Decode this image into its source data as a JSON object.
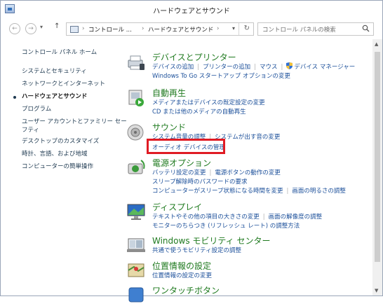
{
  "window": {
    "title": "ハードウェアとサウンド"
  },
  "address": {
    "segments": [
      "コントロール ...",
      "ハードウェアとサウンド"
    ],
    "search_placeholder": "コントロール パネルの検索"
  },
  "leftnav": {
    "home": "コントロール パネル ホーム",
    "items": [
      "システムとセキュリティ",
      "ネットワークとインターネット",
      "ハードウェアとサウンド",
      "プログラム",
      "ユーザー アカウントとファミリー セー",
      "フティ",
      "デスクトップのカスタマイズ",
      "時計、言語、および地域",
      "コンピューターの簡単操作"
    ]
  },
  "categories": {
    "devices": {
      "title": "デバイスとプリンター",
      "links": [
        "デバイスの追加",
        "プリンターの追加",
        "マウス",
        "デバイス マネージャー",
        "Windows To Go スタートアップ オプションの変更"
      ]
    },
    "autoplay": {
      "title": "自動再生",
      "links": [
        "メディアまたはデバイスの既定設定の変更",
        "CD または他のメディアの自動再生"
      ]
    },
    "sound": {
      "title": "サウンド",
      "links": [
        "システム音量の調整",
        "システムが出す音の変更",
        "オーディオ デバイスの管理"
      ]
    },
    "power": {
      "title": "電源オプション",
      "links": [
        "バッテリ設定の変更",
        "電源ボタンの動作の変更",
        "スリープ解除時のパスワードの要求",
        "コンピューターがスリープ状態になる時間を変更",
        "画面の明るさの調整"
      ]
    },
    "display": {
      "title": "ディスプレイ",
      "links": [
        "テキストやその他の項目の大きさの変更",
        "画面の解像度の調整",
        "モニターのちらつき (リフレッシュ レート) の調整方法"
      ]
    },
    "mobility": {
      "title": "Windows モビリティ センター",
      "links": [
        "共通で使うモビリティ設定の調整"
      ]
    },
    "location": {
      "title": "位置情報の設定",
      "links": [
        "位置情報の設定の変更"
      ]
    },
    "onetouch": {
      "title": "ワンタッチボタン"
    }
  },
  "colors": {
    "heading": "#1f7a1f",
    "link": "#1b4f9a",
    "highlight": "#e01b24"
  }
}
